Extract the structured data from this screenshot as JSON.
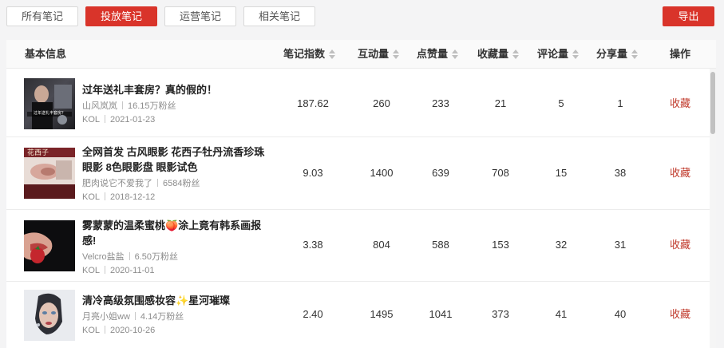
{
  "tabs": [
    {
      "label": "所有笔记",
      "active": false
    },
    {
      "label": "投放笔记",
      "active": true
    },
    {
      "label": "运营笔记",
      "active": false
    },
    {
      "label": "相关笔记",
      "active": false
    }
  ],
  "export_label": "导出",
  "columns": {
    "basic": "基本信息",
    "index": "笔记指数",
    "interactions": "互动量",
    "likes": "点赞量",
    "favorites": "收藏量",
    "comments": "评论量",
    "shares": "分享量",
    "action": "操作"
  },
  "rows": [
    {
      "title": "过年送礼丰套房？真的假的！",
      "author": "山风岚岚",
      "fans": "16.15万粉丝",
      "type": "KOL",
      "date": "2021-01-23",
      "thumb_text": "过年送礼丰套房？",
      "index": "187.62",
      "interactions": "260",
      "likes": "233",
      "favorites": "21",
      "comments": "5",
      "shares": "1",
      "action": "收藏"
    },
    {
      "title": "全网首发 古风眼影 花西子牡丹流香珍珠眼影 8色眼影盘 眼影试色",
      "author": "肥肉说它不爱我了",
      "fans": "6584粉丝",
      "type": "KOL",
      "date": "2018-12-12",
      "thumb_text": "花西子",
      "index": "9.03",
      "interactions": "1400",
      "likes": "639",
      "favorites": "708",
      "comments": "15",
      "shares": "38",
      "action": "收藏"
    },
    {
      "title": "雾蒙蒙的温柔蜜桃🍑涂上竟有韩系画报感!",
      "author": "Velcro盐盐",
      "fans": "6.50万粉丝",
      "type": "KOL",
      "date": "2020-11-01",
      "thumb_text": "",
      "index": "3.38",
      "interactions": "804",
      "likes": "588",
      "favorites": "153",
      "comments": "32",
      "shares": "31",
      "action": "收藏"
    },
    {
      "title": "清冷高级氛围感妆容✨星河璀璨",
      "author": "月亮小姐ww",
      "fans": "4.14万粉丝",
      "type": "KOL",
      "date": "2020-10-26",
      "thumb_text": "",
      "index": "2.40",
      "interactions": "1495",
      "likes": "1041",
      "favorites": "373",
      "comments": "41",
      "shares": "40",
      "action": "收藏"
    }
  ]
}
